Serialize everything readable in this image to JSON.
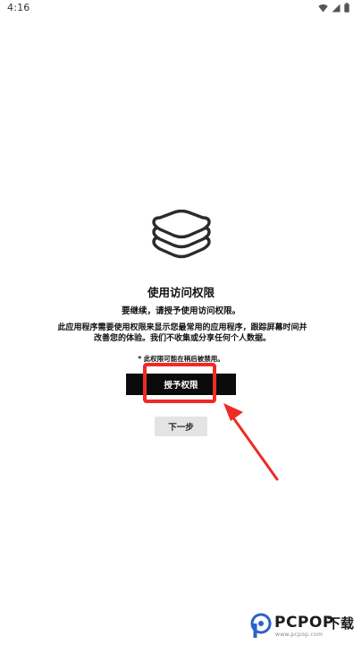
{
  "status_bar": {
    "time": "4:16",
    "icons": [
      "wifi-icon",
      "signal-icon",
      "battery-icon"
    ]
  },
  "permission_screen": {
    "icon": "stacked-layers-icon",
    "title": "使用访问权限",
    "subtitle": "要继续，请授予使用访问权限。",
    "description": "此应用程序需要使用权限来显示您最常用的应用程序，跟踪屏幕时间并改善您的体验。我们不收集或分享任何个人数据。",
    "note": "* 此权限可能在稍后被禁用。",
    "grant_button_label": "授予权限",
    "next_button_label": "下一步"
  },
  "annotation": {
    "highlight_color": "#ee2b24",
    "arrow_color": "#ee2b24"
  },
  "watermark": {
    "brand": "PCPOP",
    "suffix": "下载",
    "tagline": "www.pcpop.com"
  }
}
